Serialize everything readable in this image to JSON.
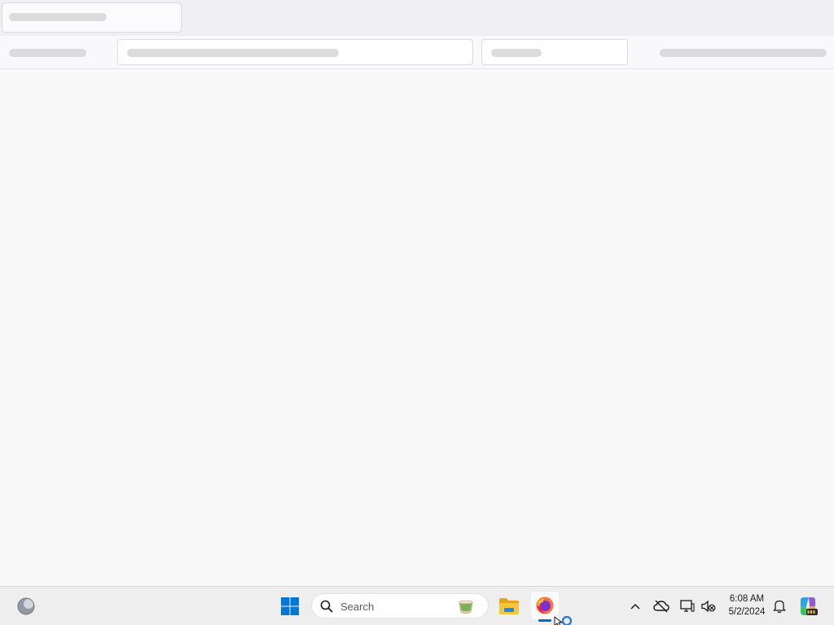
{
  "taskbar": {
    "search_placeholder": "Search",
    "clock_time": "6:08 AM",
    "clock_date": "5/2/2024",
    "icons": {
      "widgets": "weather-widget-icon",
      "start": "windows-start-icon",
      "search": "search-icon",
      "search_highlight": "cup-icon",
      "file_explorer": "folder-icon",
      "firefox": "firefox-icon",
      "tray_overflow": "chevron-up-icon",
      "onedrive": "cloud-offline-icon",
      "network": "network-icon",
      "volume": "volume-muted-icon",
      "notifications": "bell-icon",
      "copilot": "copilot-icon"
    },
    "colors": {
      "accent": "#0067c0",
      "windows_blue": "#0078d4",
      "folder_yellow": "#f6c445"
    }
  }
}
